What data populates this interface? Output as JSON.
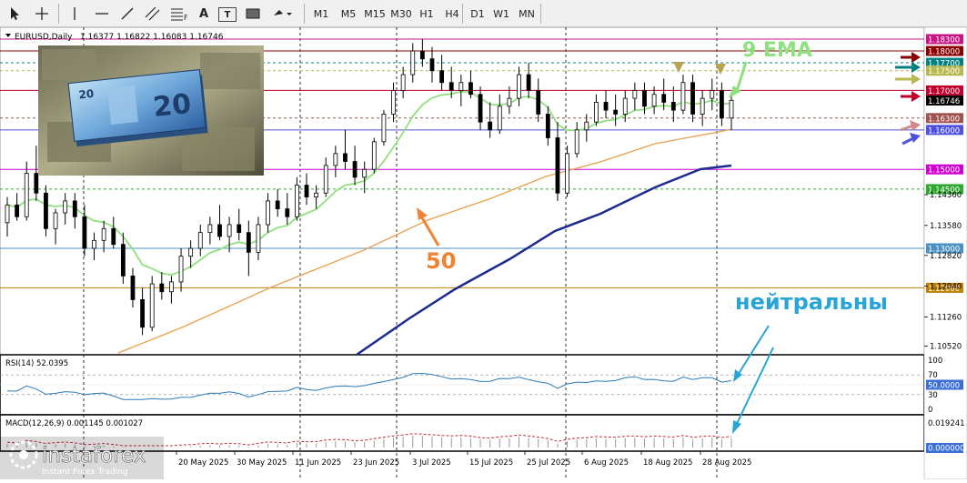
{
  "toolbar": {
    "timeframes": [
      "M1",
      "M5",
      "M15",
      "M30",
      "H1",
      "H4",
      "D1",
      "W1",
      "MN"
    ],
    "icons": [
      "cursor-icon",
      "crosshair-icon",
      "vertical-line-icon",
      "horizontal-line-icon",
      "trend-line-icon",
      "channel-icon",
      "fibonacci-icon",
      "text-icon",
      "text-label-icon",
      "rectangle-icon",
      "shapes-menu-icon"
    ],
    "fib_label": "F",
    "text_label": "A",
    "textbox_label": "T"
  },
  "symbol": {
    "name": "EURUSD,Daily",
    "ohlc": "1.16377 1.16822 1.16083 1.16746"
  },
  "chart_data": [
    {
      "type": "candlestick",
      "title": "EURUSD,Daily",
      "ylim": [
        1.1035,
        1.186
      ],
      "dates": [
        "20 May 2025",
        "30 May 2025",
        "11 Jun 2025",
        "23 Jun 2025",
        "3 Jul 2025",
        "15 Jul 2025",
        "25 Jul 2025",
        "6 Aug 2025",
        "18 Aug 2025",
        "28 Aug 2025"
      ],
      "price_ticks": [
        "1.14360",
        "1.13580",
        "1.12820",
        "1.12040",
        "1.11260",
        "1.10520"
      ],
      "levels": [
        {
          "value": 1.183,
          "label": "1.18300",
          "color": "#c71585",
          "style": "solid"
        },
        {
          "value": 1.18,
          "label": "1.18000",
          "color": "#8b0000",
          "style": "solid"
        },
        {
          "value": 1.177,
          "label": "1.17700",
          "color": "#008080",
          "style": "dashed"
        },
        {
          "value": 1.175,
          "label": "1.17500",
          "color": "#b8b850",
          "style": "dashed"
        },
        {
          "value": 1.17,
          "label": "1.17000",
          "color": "#c0002a",
          "style": "solid"
        },
        {
          "value": 1.163,
          "label": "1.16300",
          "color": "#a0524e",
          "style": "dashed"
        },
        {
          "value": 1.16,
          "label": "1.16000",
          "color": "#5050e0",
          "style": "solid"
        },
        {
          "value": 1.15,
          "label": "1.15000",
          "color": "#d000d0",
          "style": "solid"
        },
        {
          "value": 1.145,
          "label": "1.14500",
          "color": "#2fa82f",
          "style": "dashed"
        },
        {
          "value": 1.13,
          "label": "1.13000",
          "color": "#4a90c0",
          "style": "solid"
        },
        {
          "value": 1.12,
          "label": "1.12000",
          "color": "#c08000",
          "style": "solid"
        }
      ],
      "current_price": {
        "value": 1.16746,
        "label": "1.16746"
      },
      "candles": [
        [
          1.1365,
          1.143,
          1.133,
          1.141
        ],
        [
          1.141,
          1.144,
          1.137,
          1.138
        ],
        [
          1.138,
          1.152,
          1.137,
          1.149
        ],
        [
          1.149,
          1.156,
          1.142,
          1.144
        ],
        [
          1.144,
          1.146,
          1.133,
          1.135
        ],
        [
          1.135,
          1.14,
          1.131,
          1.139
        ],
        [
          1.139,
          1.144,
          1.136,
          1.142
        ],
        [
          1.142,
          1.144,
          1.135,
          1.138
        ],
        [
          1.138,
          1.141,
          1.128,
          1.13
        ],
        [
          1.13,
          1.134,
          1.127,
          1.132
        ],
        [
          1.132,
          1.137,
          1.129,
          1.135
        ],
        [
          1.135,
          1.138,
          1.13,
          1.131
        ],
        [
          1.131,
          1.134,
          1.121,
          1.123
        ],
        [
          1.123,
          1.125,
          1.115,
          1.117
        ],
        [
          1.117,
          1.12,
          1.108,
          1.11
        ],
        [
          1.11,
          1.123,
          1.109,
          1.121
        ],
        [
          1.121,
          1.124,
          1.117,
          1.119
        ],
        [
          1.119,
          1.123,
          1.116,
          1.1215
        ],
        [
          1.1215,
          1.13,
          1.119,
          1.128
        ],
        [
          1.128,
          1.132,
          1.125,
          1.13
        ],
        [
          1.13,
          1.136,
          1.128,
          1.134
        ],
        [
          1.134,
          1.138,
          1.131,
          1.136
        ],
        [
          1.136,
          1.141,
          1.132,
          1.133
        ],
        [
          1.133,
          1.138,
          1.129,
          1.136
        ],
        [
          1.136,
          1.14,
          1.132,
          1.134
        ],
        [
          1.134,
          1.137,
          1.123,
          1.129
        ],
        [
          1.129,
          1.138,
          1.127,
          1.136
        ],
        [
          1.136,
          1.144,
          1.134,
          1.142
        ],
        [
          1.142,
          1.145,
          1.138,
          1.14
        ],
        [
          1.14,
          1.144,
          1.136,
          1.138
        ],
        [
          1.138,
          1.148,
          1.137,
          1.146
        ],
        [
          1.146,
          1.149,
          1.141,
          1.143
        ],
        [
          1.143,
          1.146,
          1.14,
          1.144
        ],
        [
          1.144,
          1.153,
          1.143,
          1.151
        ],
        [
          1.151,
          1.156,
          1.148,
          1.154
        ],
        [
          1.154,
          1.16,
          1.15,
          1.152
        ],
        [
          1.152,
          1.156,
          1.146,
          1.148
        ],
        [
          1.148,
          1.152,
          1.144,
          1.15
        ],
        [
          1.15,
          1.158,
          1.149,
          1.157
        ],
        [
          1.157,
          1.165,
          1.156,
          1.164
        ],
        [
          1.164,
          1.172,
          1.162,
          1.17
        ],
        [
          1.17,
          1.176,
          1.168,
          1.174
        ],
        [
          1.174,
          1.182,
          1.172,
          1.18
        ],
        [
          1.18,
          1.183,
          1.176,
          1.178
        ],
        [
          1.178,
          1.181,
          1.172,
          1.175
        ],
        [
          1.175,
          1.179,
          1.17,
          1.172
        ],
        [
          1.172,
          1.176,
          1.168,
          1.17
        ],
        [
          1.17,
          1.174,
          1.166,
          1.172
        ],
        [
          1.172,
          1.175,
          1.168,
          1.169
        ],
        [
          1.169,
          1.171,
          1.16,
          1.162
        ],
        [
          1.162,
          1.167,
          1.158,
          1.16
        ],
        [
          1.16,
          1.169,
          1.159,
          1.166
        ],
        [
          1.166,
          1.171,
          1.164,
          1.168
        ],
        [
          1.168,
          1.176,
          1.166,
          1.174
        ],
        [
          1.174,
          1.177,
          1.168,
          1.17
        ],
        [
          1.17,
          1.173,
          1.162,
          1.164
        ],
        [
          1.164,
          1.166,
          1.156,
          1.158
        ],
        [
          1.158,
          1.162,
          1.142,
          1.144
        ],
        [
          1.144,
          1.156,
          1.143,
          1.154
        ],
        [
          1.154,
          1.162,
          1.153,
          1.16
        ],
        [
          1.16,
          1.164,
          1.157,
          1.162
        ],
        [
          1.162,
          1.169,
          1.161,
          1.167
        ],
        [
          1.167,
          1.17,
          1.163,
          1.165
        ],
        [
          1.165,
          1.169,
          1.161,
          1.164
        ],
        [
          1.164,
          1.17,
          1.162,
          1.168
        ],
        [
          1.168,
          1.172,
          1.165,
          1.17
        ],
        [
          1.17,
          1.172,
          1.164,
          1.166
        ],
        [
          1.166,
          1.171,
          1.164,
          1.169
        ],
        [
          1.169,
          1.173,
          1.165,
          1.167
        ],
        [
          1.167,
          1.171,
          1.162,
          1.165
        ],
        [
          1.165,
          1.174,
          1.164,
          1.172
        ],
        [
          1.172,
          1.174,
          1.162,
          1.164
        ],
        [
          1.164,
          1.17,
          1.161,
          1.168
        ],
        [
          1.168,
          1.173,
          1.165,
          1.17
        ],
        [
          1.17,
          1.172,
          1.161,
          1.163
        ],
        [
          1.163,
          1.169,
          1.16,
          1.1675
        ]
      ]
    },
    {
      "type": "line",
      "title": "RSI(14) 52.0395",
      "ylim": [
        0,
        100
      ],
      "ticks": [
        "100",
        "70",
        "30",
        "0"
      ],
      "current": "50.0000"
    },
    {
      "type": "bar",
      "title": "MACD(12,26,9) 0.001145 0.001027",
      "ticks": [
        "0.019241"
      ],
      "current": "0.000000"
    }
  ],
  "annotations": {
    "ema9_label": "9 EMA",
    "ma50_label": "50",
    "neutral_label": "нейтральны"
  },
  "watermark": {
    "brand": "instaforex",
    "tagline": "Instant Forex Trading"
  },
  "banknote": {
    "denomination": "20"
  }
}
